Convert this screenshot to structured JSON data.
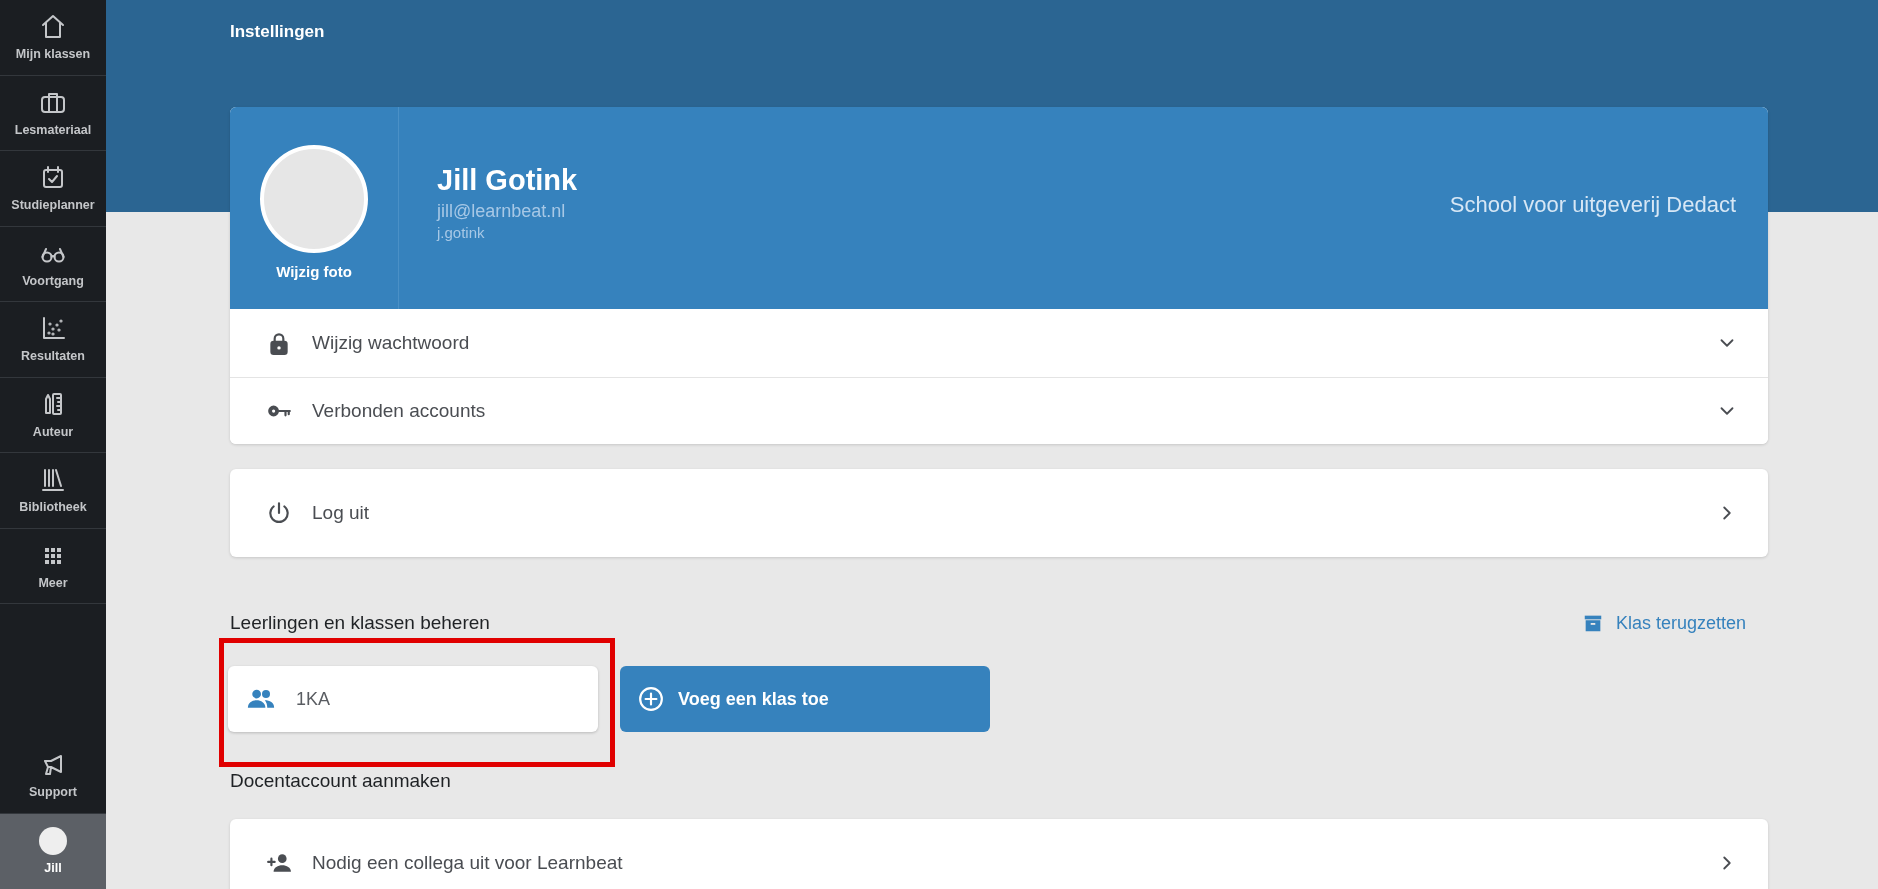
{
  "sidebar": {
    "items": [
      {
        "label": "Mijn klassen",
        "selected": false
      },
      {
        "label": "Lesmateriaal",
        "selected": false
      },
      {
        "label": "Studieplanner",
        "selected": false
      },
      {
        "label": "Voortgang",
        "selected": false
      },
      {
        "label": "Resultaten",
        "selected": false
      },
      {
        "label": "Auteur",
        "selected": false
      },
      {
        "label": "Bibliotheek",
        "selected": false
      },
      {
        "label": "Meer",
        "selected": false
      }
    ],
    "bottom_items": [
      {
        "label": "Support",
        "kind": "icon",
        "selected": false
      },
      {
        "label": "Jill",
        "kind": "avatar",
        "selected": true
      }
    ]
  },
  "page_title": "Instellingen",
  "profile": {
    "photo_label": "Wijzig foto",
    "name": "Jill Gotink",
    "email": "jill@learnbeat.nl",
    "username": "j.gotink",
    "school": "School voor uitgeverij Dedact",
    "rows": [
      {
        "label": "Wijzig wachtwoord",
        "expanded": false
      },
      {
        "label": "Verbonden accounts",
        "expanded": false
      }
    ]
  },
  "logout": {
    "label": "Log uit"
  },
  "classes": {
    "title": "Leerlingen en klassen beheren",
    "restore_link": "Klas terugzetten",
    "items": [
      {
        "name": "1KA",
        "highlighted": true
      }
    ],
    "add_button": "Voeg een klas toe"
  },
  "teacher_account": {
    "title": "Docentaccount aanmaken",
    "rows": [
      {
        "label": "Nodig een collega uit voor Learnbeat"
      }
    ]
  }
}
